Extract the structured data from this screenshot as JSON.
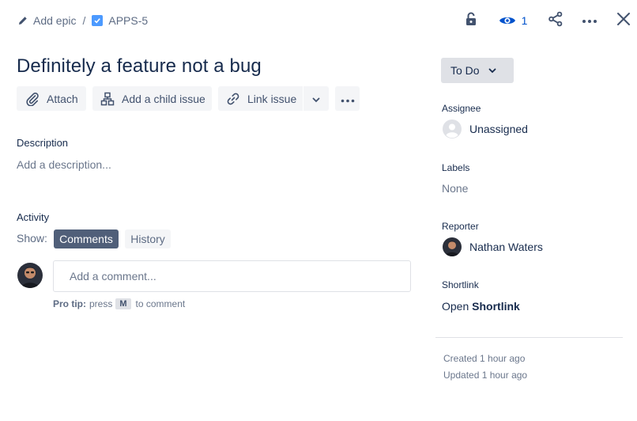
{
  "breadcrumb": {
    "add_epic": "Add epic",
    "separator": "/",
    "issue_key": "APPS-5"
  },
  "header": {
    "watch_count": "1"
  },
  "issue": {
    "title": "Definitely a feature not a bug"
  },
  "toolbar": {
    "attach": "Attach",
    "add_child": "Add a child issue",
    "link_issue": "Link issue"
  },
  "description": {
    "label": "Description",
    "placeholder": "Add a description..."
  },
  "activity": {
    "label": "Activity",
    "show_label": "Show:",
    "tabs": [
      "Comments",
      "History"
    ],
    "active_tab": "Comments",
    "comment_placeholder": "Add a comment...",
    "protip_bold": "Pro tip:",
    "protip_pre": "press",
    "protip_key": "M",
    "protip_post": "to comment"
  },
  "sidebar": {
    "status": "To Do",
    "assignee_label": "Assignee",
    "assignee_value": "Unassigned",
    "labels_label": "Labels",
    "labels_value": "None",
    "reporter_label": "Reporter",
    "reporter_value": "Nathan Waters",
    "shortlink_label": "Shortlink",
    "shortlink_pre": "Open",
    "shortlink_link": "Shortlink",
    "created": "Created 1 hour ago",
    "updated": "Updated 1 hour ago"
  },
  "colors": {
    "accent_blue": "#0052cc",
    "checkbox_blue": "#4c9aff",
    "text_primary": "#172b4d",
    "text_muted": "#6b778c",
    "button_bg": "#f4f5f7",
    "tab_active_bg": "#505f79"
  },
  "icons": {
    "add_epic": "pencil-icon",
    "issue_type": "checkbox-icon",
    "lock": "lock-icon",
    "watch": "eye-icon",
    "share": "share-icon",
    "more": "more-icon",
    "close": "close-icon",
    "attach": "paperclip-icon",
    "child": "hierarchy-icon",
    "link": "link-icon"
  }
}
